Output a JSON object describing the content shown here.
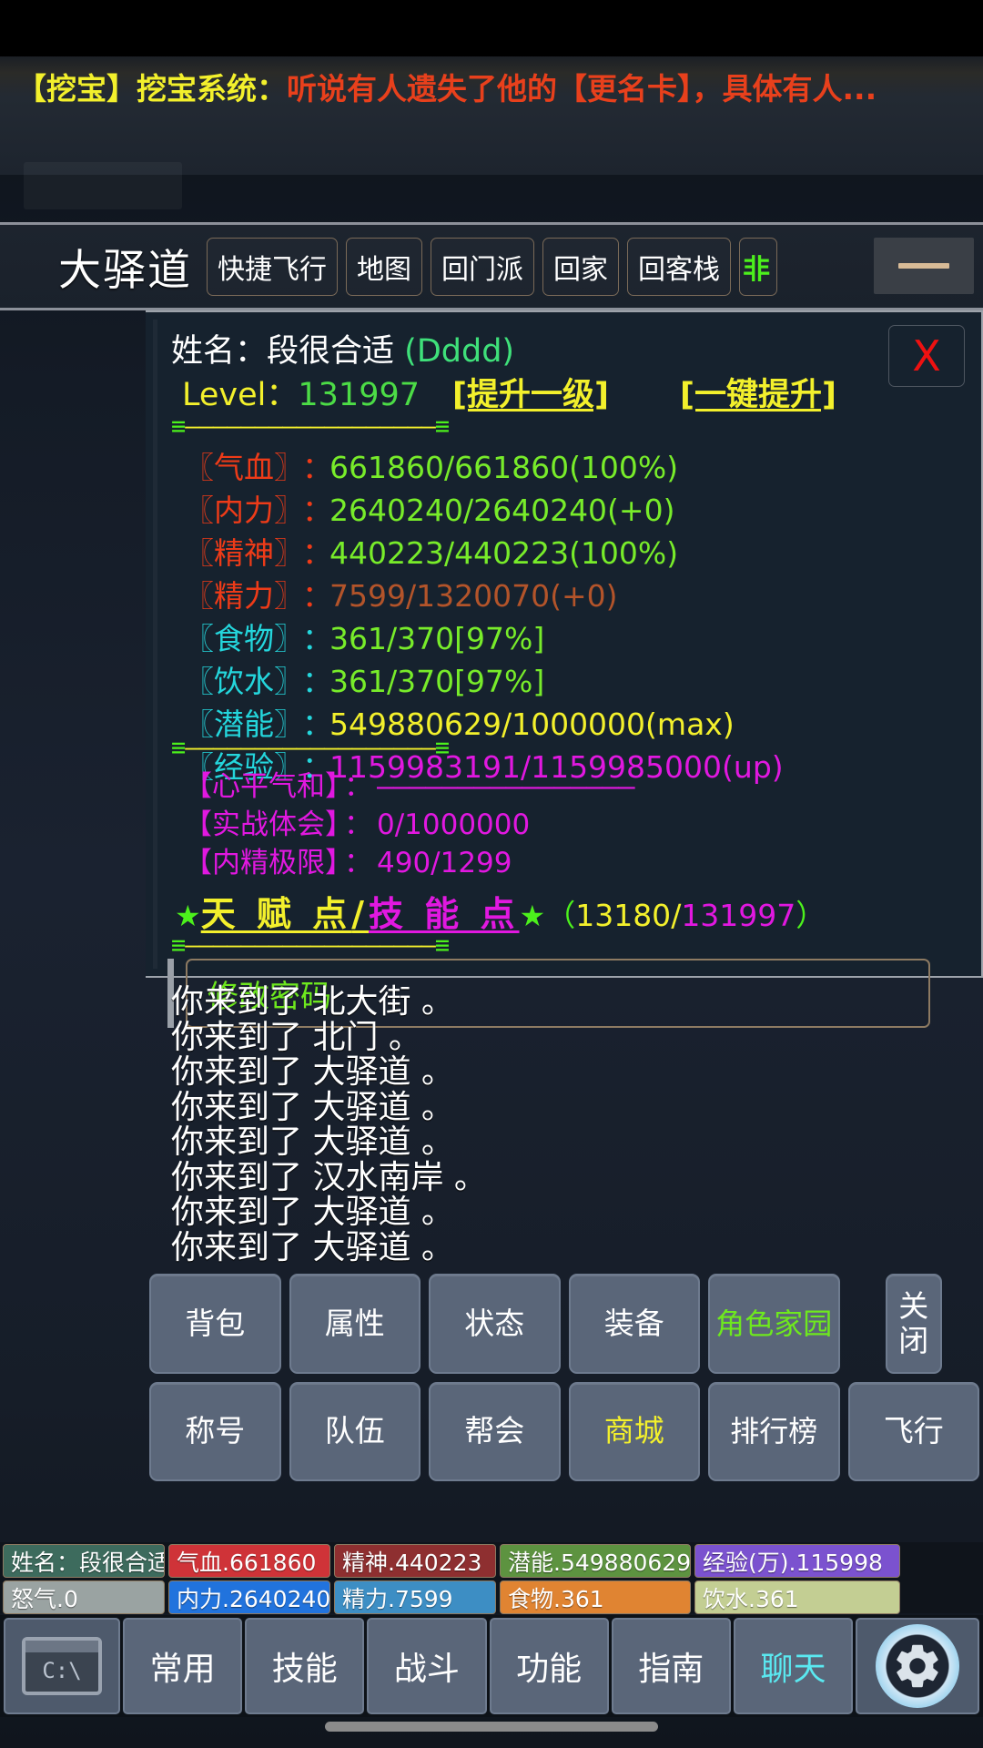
{
  "broadcast": {
    "tag": "【挖宝】",
    "system": "挖宝系统：",
    "message": "听说有人遗失了他的【更名卡】，具体有人..."
  },
  "toolbar": {
    "location": "大驿道",
    "buttons": [
      {
        "label": "快捷飞行"
      },
      {
        "label": "地图"
      },
      {
        "label": "回门派"
      },
      {
        "label": "回家"
      },
      {
        "label": "回客栈"
      },
      {
        "label": "非"
      }
    ],
    "minimize_label": "—"
  },
  "char_panel": {
    "name_label": "姓名：",
    "name_value": "段很合适",
    "nickname": "(Dddd)",
    "level_label": "Level：",
    "level_value": "131997",
    "level_up_one": "[提升一级]",
    "level_up_all": "[一键提升]",
    "close_label": "X",
    "divider": "≡——————————————————≡",
    "stats": [
      {
        "label": "〖气血〗",
        "colon": "：",
        "value": "661860/661860(100%)",
        "label_color": "red",
        "value_color": "green"
      },
      {
        "label": "〖内力〗",
        "colon": "：",
        "value": "2640240/2640240(+0)",
        "label_color": "red",
        "value_color": "green"
      },
      {
        "label": "〖精神〗",
        "colon": "：",
        "value": "440223/440223(100%)",
        "label_color": "red",
        "value_color": "green"
      },
      {
        "label": "〖精力〗",
        "colon": "：",
        "value": "7599/1320070(+0)",
        "label_color": "red",
        "value_color": "brown"
      },
      {
        "label": "〖食物〗",
        "colon": "：",
        "value": "361/370[97%]",
        "label_color": "cyan",
        "value_color": "green"
      },
      {
        "label": "〖饮水〗",
        "colon": "：",
        "value": "361/370[97%]",
        "label_color": "cyan",
        "value_color": "green"
      },
      {
        "label": "〖潜能〗",
        "colon": "：",
        "value": "549880629/1000000(max)",
        "label_color": "cyan",
        "value_color": "yellow"
      },
      {
        "label": "〖经验〗",
        "colon": "：",
        "value": "1159983191/1159985000(up)",
        "label_color": "cyan",
        "value_color": "magenta"
      }
    ],
    "stats2": [
      {
        "label": "【心平气和】",
        "colon": "：",
        "value": "————————————————"
      },
      {
        "label": "【实战体会】",
        "colon": "：",
        "value": "0/1000000"
      },
      {
        "label": "【内精极限】",
        "colon": "：",
        "value": "490/1299"
      }
    ],
    "talent": {
      "star": "★",
      "talent_label": "天 赋 点",
      "slash": "/",
      "skill_label": "技 能 点",
      "open_paren": "（",
      "talent_points": "13180",
      "point_slash": "/",
      "skill_points": "131997",
      "close_paren": "）"
    },
    "password_button": "修改密码"
  },
  "message_log": [
    "你来到了 北大街 。",
    "你来到了 北门 。",
    "你来到了 大驿道 。",
    "你来到了 大驿道 。",
    "你来到了 大驿道 。",
    "你来到了 汉水南岸 。",
    "你来到了 大驿道 。",
    "你来到了 大驿道 。"
  ],
  "button_grid": [
    {
      "label": "背包",
      "color": "white"
    },
    {
      "label": "属性",
      "color": "white"
    },
    {
      "label": "状态",
      "color": "white"
    },
    {
      "label": "装备",
      "color": "white"
    },
    {
      "label": "角色家园",
      "color": "green"
    },
    {
      "label": "关闭",
      "color": "white"
    },
    {
      "label": "称号",
      "color": "white"
    },
    {
      "label": "队伍",
      "color": "white"
    },
    {
      "label": "帮会",
      "color": "white"
    },
    {
      "label": "商城",
      "color": "yellow"
    },
    {
      "label": "排行榜",
      "color": "white"
    },
    {
      "label": "飞行",
      "color": "white"
    }
  ],
  "status_chips": [
    {
      "label": "姓名：段很合适",
      "bg": "#3d6b5d"
    },
    {
      "label": "气血.661860",
      "bg": "#cf3338"
    },
    {
      "label": "精神.440223",
      "bg": "#8e2f30"
    },
    {
      "label": "潜能.549880629",
      "bg": "#5d9340"
    },
    {
      "label": "经验(万).115998",
      "bg": "#7b52cf"
    },
    {
      "label": "怒气.0",
      "bg": "#9aa3a2"
    },
    {
      "label": "内力.2640240",
      "bg": "#2173dd"
    },
    {
      "label": "精力.7599",
      "bg": "#3d8ec4"
    },
    {
      "label": "食物.361",
      "bg": "#e08432"
    },
    {
      "label": "饮水.361",
      "bg": "#c3ce93"
    }
  ],
  "bottom_nav": [
    {
      "label": "C:\\",
      "type": "console"
    },
    {
      "label": "常用",
      "type": "text",
      "color": "white"
    },
    {
      "label": "技能",
      "type": "text",
      "color": "white"
    },
    {
      "label": "战斗",
      "type": "text",
      "color": "white"
    },
    {
      "label": "功能",
      "type": "text",
      "color": "white"
    },
    {
      "label": "指南",
      "type": "text",
      "color": "white"
    },
    {
      "label": "聊天",
      "type": "text",
      "color": "cyan"
    },
    {
      "label": "settings-gear",
      "type": "gear"
    }
  ]
}
